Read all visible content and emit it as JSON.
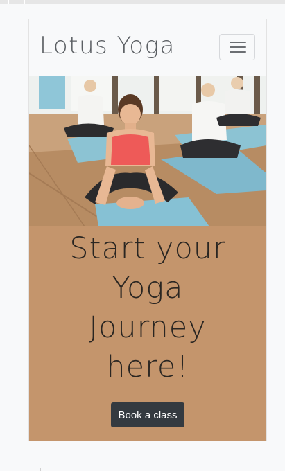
{
  "navbar": {
    "brand": "Lotus Yoga",
    "toggler_icon": "hamburger-icon"
  },
  "hero_image": {
    "icon": "yoga-class-photo"
  },
  "hero": {
    "headline_lines": [
      "Start your",
      "Yoga",
      "Journey",
      "here!"
    ],
    "button_label": "Book a class"
  },
  "colors": {
    "hero_background": "#c4956c",
    "button_background": "#343a40",
    "navbar_background": "#f8f9fa"
  }
}
